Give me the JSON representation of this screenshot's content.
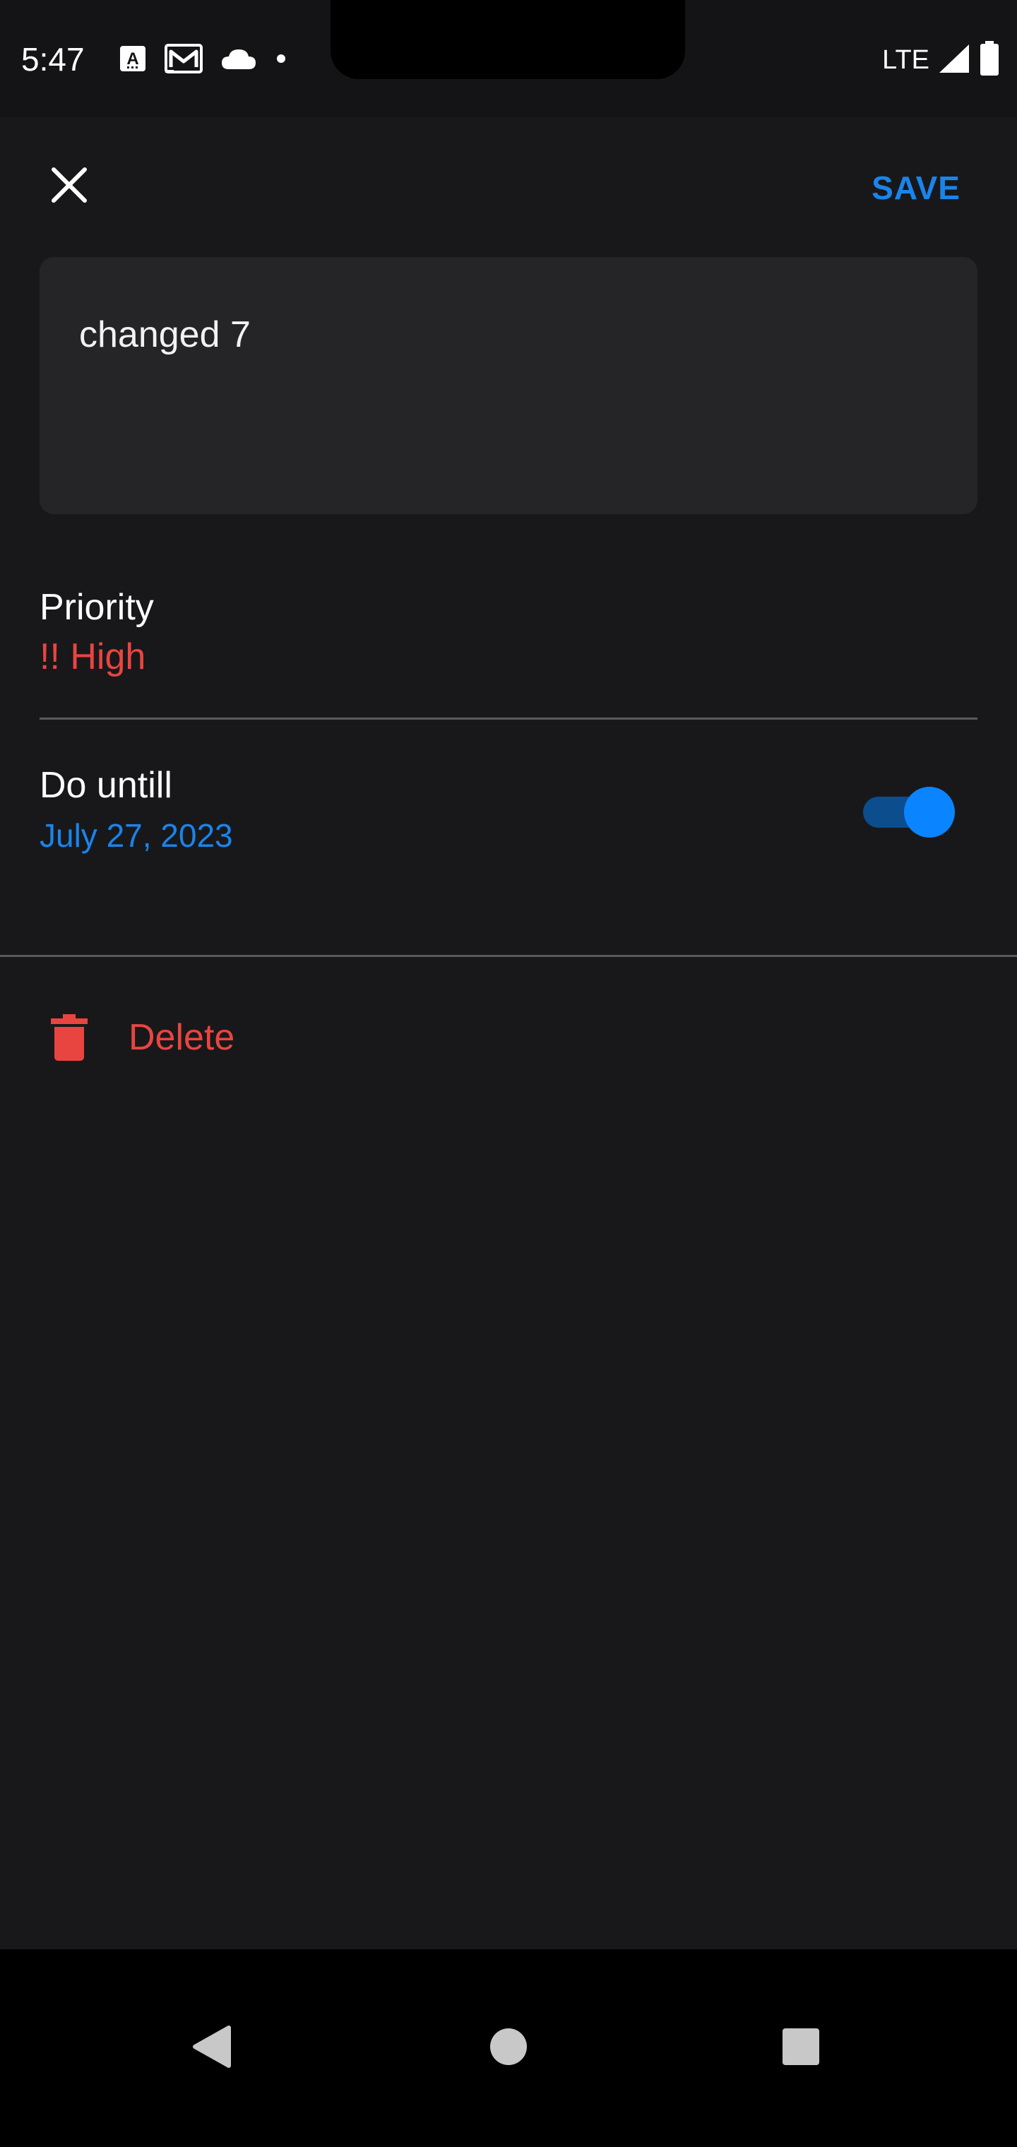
{
  "status_bar": {
    "time": "5:47",
    "network": "LTE",
    "icons": [
      "text-recognition-icon",
      "gmail-icon",
      "cloud-icon",
      "dot-icon",
      "signal-icon",
      "battery-icon"
    ]
  },
  "header": {
    "close_icon": "close-icon",
    "save_label": "SAVE"
  },
  "task": {
    "text": "changed 7"
  },
  "priority": {
    "label": "Priority",
    "value": "!! High"
  },
  "due": {
    "label": "Do untill",
    "date": "July 27, 2023",
    "enabled": true
  },
  "delete": {
    "label": "Delete",
    "icon": "trash-icon"
  },
  "nav": {
    "icons": [
      "back-icon",
      "home-icon",
      "recents-icon"
    ]
  },
  "colors": {
    "background": "#18181b",
    "accent_blue": "#1a84ea",
    "danger_red": "#e94540",
    "card": "#252528"
  }
}
